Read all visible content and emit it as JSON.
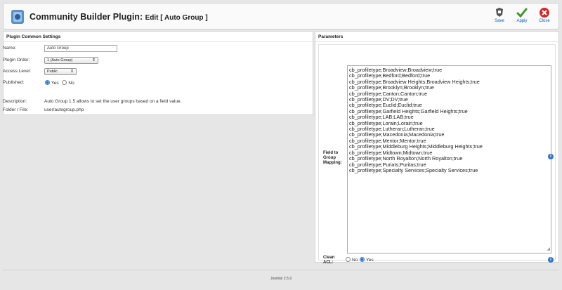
{
  "header": {
    "title_main": "Community Builder Plugin:",
    "title_sub": "Edit [ Auto Group ]",
    "toolbar": [
      {
        "label": "Save",
        "icon": "save-icon"
      },
      {
        "label": "Apply",
        "icon": "apply-icon"
      },
      {
        "label": "Close",
        "icon": "close-icon"
      }
    ]
  },
  "common": {
    "title": "Plugin Common Settings",
    "name_label": "Name:",
    "name_value": "Auto Group",
    "order_label": "Plugin Order:",
    "order_value": "1 (Auto Group)",
    "access_label": "Access Level:",
    "access_value": "Public",
    "published_label": "Published:",
    "published_yes": "Yes",
    "published_no": "No",
    "description_label": "Description:",
    "description_value": "Auto Group 1.5 allows to set the user groups based on a field value.",
    "folder_label": "Folder / File:",
    "folder_value": "user/autogroup.php"
  },
  "params": {
    "title": "Parameters",
    "mapping_label": "Field to Group Mapping:",
    "mapping_value": "cb_profiletype;Broadview;Broadview;true\ncb_profiletype;Bedford;Bedford;true\ncb_profiletype;Broadview Heights;Broadview Heights;true\ncb_profiletype;Brooklyn;Brooklyn;true\ncb_profiletype;Canton;Canton;true\ncb_profiletype;DV;DV;true\ncb_profiletype;Euclid;Euclid;true\ncb_profiletype;Garfield Heights;Garfield Heights;true\ncb_profiletype;LAB;LAB;true\ncb_profiletype;Lorain;Lorain;true\ncb_profiletype;Lutheran;Lutheran;true\ncb_profiletype;Macedonia;Macedonia;true\ncb_profiletype;Mentor;Mentor;true\ncb_profiletype;Middleburg Heights;Middleburg Heights;true\ncb_profiletype;Midtown;Midtown;true\ncb_profiletype;North Royalton;North Royalton;true\ncb_profiletype;Puriats;Puritas;true\ncb_profiletype;Specialty Services;Specialty Services;true",
    "clean_label": "Clean ACL:",
    "clean_no": "No",
    "clean_yes": "Yes"
  },
  "footer": {
    "version": "Joomla! 2.5.9"
  }
}
